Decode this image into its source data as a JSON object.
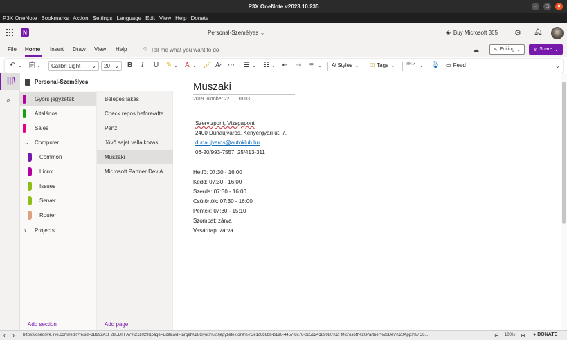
{
  "window": {
    "title": "P3X OneNote v2023.10.235"
  },
  "menubar": {
    "items": [
      "P3X OneNote",
      "Bookmarks",
      "Action",
      "Settings",
      "Language",
      "Edit",
      "View",
      "Help",
      "Donate"
    ]
  },
  "appbar": {
    "doc_title": "Personal-Személyes",
    "buy_label": "Buy Microsoft 365"
  },
  "ribbon": {
    "tabs": [
      "File",
      "Home",
      "Insert",
      "Draw",
      "View",
      "Help"
    ],
    "tell_me": "Tell me what you want to do",
    "editing_label": "Editing",
    "share_label": "Share"
  },
  "toolbar": {
    "font_name": "Calibri Light",
    "font_size": "20",
    "styles_label": "Styles",
    "tags_label": "Tags",
    "feed_label": "Feed"
  },
  "notebook": {
    "name": "Personal-Személyes"
  },
  "sections": [
    {
      "label": "Gyors jegyzetek",
      "color": "#b4009e"
    },
    {
      "label": "Általános",
      "color": "#13a10e"
    },
    {
      "label": "Sales",
      "color": "#e3008c"
    },
    {
      "label": "Computer",
      "group": true
    },
    {
      "label": "Common",
      "color": "#7719aa"
    },
    {
      "label": "Linux",
      "color": "#b4009e"
    },
    {
      "label": "Issues",
      "color": "#8cbd18"
    },
    {
      "label": "Server",
      "color": "#8cbd18"
    },
    {
      "label": "Router",
      "color": "#d8a37e"
    },
    {
      "label": "Projects",
      "group": true
    }
  ],
  "pages": [
    "Belépés lakás",
    "Check repos before/afte...",
    "Pénz",
    "Jövő sajat vallalkozas",
    "Muszaki",
    "Microsoft Partner Dev A..."
  ],
  "footer": {
    "add_section": "Add section",
    "add_page": "Add page"
  },
  "note": {
    "title": "Muszaki",
    "date": "2019. október 22.",
    "time": "10:03",
    "address": [
      "Szervizpont, Vizsgapont",
      "2400 Dunaújváros, Kenyérgyári út. 7."
    ],
    "email": "dunaujvaros@autoklub.hu",
    "phone": "06-20/993-7557; 25/413-311",
    "hours": [
      "Hétfő: 07:30 - 16:00",
      "Kedd: 07:30 - 16:00",
      "Szerda: 07:30 - 16:00",
      "Csütörtök: 07:30 - 16:00",
      "Péntek: 07:30 - 15:10",
      "Szombat: zárva",
      "Vasárnap: zárva"
    ]
  },
  "status": {
    "url": "https://onedrive.live.com/redir?resid=3B992A1F2BEDFFA7%211029&page=Edit&wd=target%28Gyors%20jegyzetek.one%7Ce1c0b6bb-b190-4457-8c76-0d5824189080%2FMicrosoft%20Partner%20Dev%20Apps%7C6...",
    "zoom": "100%",
    "donate": "DONATE"
  }
}
